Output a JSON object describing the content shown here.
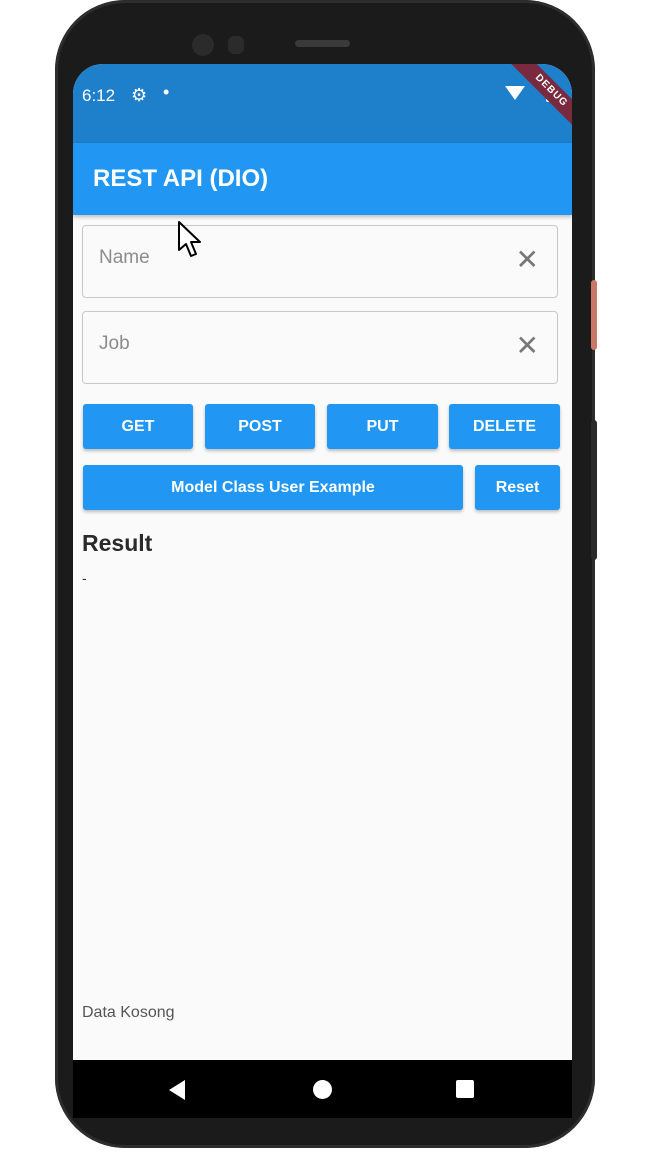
{
  "status_bar": {
    "time": "6:12",
    "debug_banner": "DEBUG"
  },
  "app_bar": {
    "title": "REST API (DIO)"
  },
  "form": {
    "name_placeholder": "Name",
    "job_placeholder": "Job",
    "name_value": "",
    "job_value": ""
  },
  "buttons": {
    "get": "GET",
    "post": "POST",
    "put": "PUT",
    "delete": "DELETE",
    "model_example": "Model Class User Example",
    "reset": "Reset"
  },
  "result": {
    "heading": "Result",
    "value": "-"
  },
  "footer": {
    "text": "Data Kosong"
  },
  "colors": {
    "primary": "#2196f3",
    "status_bar": "#1e7fcb",
    "background": "#fafafa"
  },
  "icons": {
    "settings": "gear-icon",
    "clear": "close-icon",
    "back": "back-triangle-icon",
    "home": "home-circle-icon",
    "recent": "recent-square-icon"
  }
}
